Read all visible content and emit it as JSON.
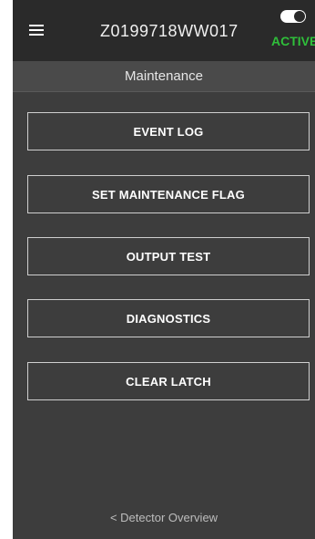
{
  "header": {
    "device_id": "Z0199718WW017",
    "status_label": "ACTIVE",
    "toggle_on": true
  },
  "subheader": {
    "title": "Maintenance"
  },
  "menu": {
    "items": [
      {
        "label": "EVENT LOG"
      },
      {
        "label": "SET MAINTENANCE FLAG"
      },
      {
        "label": "OUTPUT TEST"
      },
      {
        "label": "DIAGNOSTICS"
      },
      {
        "label": "CLEAR LATCH"
      }
    ]
  },
  "footer": {
    "back_label": "< Detector Overview"
  },
  "colors": {
    "background": "#3d3d3d",
    "topbar": "#2a2a2a",
    "active_green": "#2fbf3a",
    "button_border": "#cfcfcf"
  },
  "icons": {
    "menu": "hamburger-menu-icon",
    "toggle": "toggle-switch-icon"
  }
}
